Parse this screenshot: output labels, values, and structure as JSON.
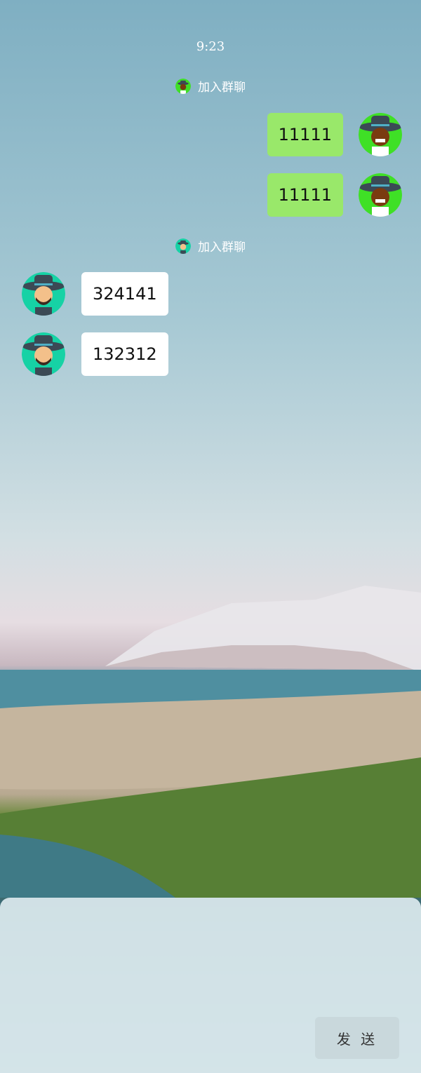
{
  "header": {
    "time": "9:23"
  },
  "messages": [
    {
      "type": "notice",
      "text": "加入群聊",
      "avatar": "dark-skin-user-icon"
    },
    {
      "type": "mine",
      "text": "11111",
      "avatar": "dark-skin-user-icon"
    },
    {
      "type": "mine",
      "text": "11111",
      "avatar": "dark-skin-user-icon"
    },
    {
      "type": "notice",
      "text": "加入群聊",
      "avatar": "bearded-user-icon"
    },
    {
      "type": "theirs",
      "text": "324141",
      "avatar": "bearded-user-icon"
    },
    {
      "type": "theirs",
      "text": "132312",
      "avatar": "bearded-user-icon"
    }
  ],
  "composer": {
    "placeholder": "",
    "send_label": "发 送"
  },
  "colors": {
    "mine_bubble": "#99e86a",
    "theirs_bubble": "#ffffff",
    "avatar_green": "#3fe026",
    "avatar_teal": "#16d2a5"
  }
}
